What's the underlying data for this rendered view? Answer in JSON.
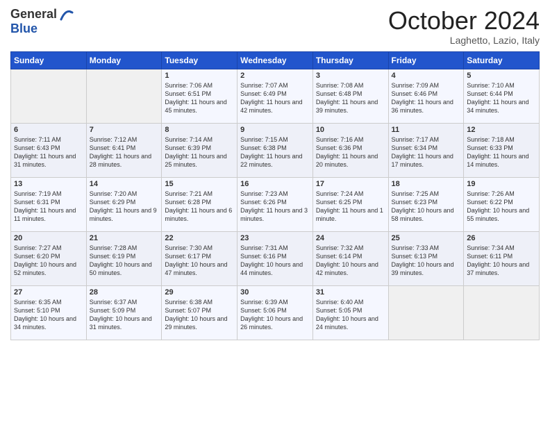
{
  "header": {
    "logo_general": "General",
    "logo_blue": "Blue",
    "title": "October 2024",
    "subtitle": "Laghetto, Lazio, Italy"
  },
  "days_of_week": [
    "Sunday",
    "Monday",
    "Tuesday",
    "Wednesday",
    "Thursday",
    "Friday",
    "Saturday"
  ],
  "weeks": [
    [
      {
        "day": null
      },
      {
        "day": null
      },
      {
        "day": "1",
        "sunrise": "Sunrise: 7:06 AM",
        "sunset": "Sunset: 6:51 PM",
        "daylight": "Daylight: 11 hours and 45 minutes."
      },
      {
        "day": "2",
        "sunrise": "Sunrise: 7:07 AM",
        "sunset": "Sunset: 6:49 PM",
        "daylight": "Daylight: 11 hours and 42 minutes."
      },
      {
        "day": "3",
        "sunrise": "Sunrise: 7:08 AM",
        "sunset": "Sunset: 6:48 PM",
        "daylight": "Daylight: 11 hours and 39 minutes."
      },
      {
        "day": "4",
        "sunrise": "Sunrise: 7:09 AM",
        "sunset": "Sunset: 6:46 PM",
        "daylight": "Daylight: 11 hours and 36 minutes."
      },
      {
        "day": "5",
        "sunrise": "Sunrise: 7:10 AM",
        "sunset": "Sunset: 6:44 PM",
        "daylight": "Daylight: 11 hours and 34 minutes."
      }
    ],
    [
      {
        "day": "6",
        "sunrise": "Sunrise: 7:11 AM",
        "sunset": "Sunset: 6:43 PM",
        "daylight": "Daylight: 11 hours and 31 minutes."
      },
      {
        "day": "7",
        "sunrise": "Sunrise: 7:12 AM",
        "sunset": "Sunset: 6:41 PM",
        "daylight": "Daylight: 11 hours and 28 minutes."
      },
      {
        "day": "8",
        "sunrise": "Sunrise: 7:14 AM",
        "sunset": "Sunset: 6:39 PM",
        "daylight": "Daylight: 11 hours and 25 minutes."
      },
      {
        "day": "9",
        "sunrise": "Sunrise: 7:15 AM",
        "sunset": "Sunset: 6:38 PM",
        "daylight": "Daylight: 11 hours and 22 minutes."
      },
      {
        "day": "10",
        "sunrise": "Sunrise: 7:16 AM",
        "sunset": "Sunset: 6:36 PM",
        "daylight": "Daylight: 11 hours and 20 minutes."
      },
      {
        "day": "11",
        "sunrise": "Sunrise: 7:17 AM",
        "sunset": "Sunset: 6:34 PM",
        "daylight": "Daylight: 11 hours and 17 minutes."
      },
      {
        "day": "12",
        "sunrise": "Sunrise: 7:18 AM",
        "sunset": "Sunset: 6:33 PM",
        "daylight": "Daylight: 11 hours and 14 minutes."
      }
    ],
    [
      {
        "day": "13",
        "sunrise": "Sunrise: 7:19 AM",
        "sunset": "Sunset: 6:31 PM",
        "daylight": "Daylight: 11 hours and 11 minutes."
      },
      {
        "day": "14",
        "sunrise": "Sunrise: 7:20 AM",
        "sunset": "Sunset: 6:29 PM",
        "daylight": "Daylight: 11 hours and 9 minutes."
      },
      {
        "day": "15",
        "sunrise": "Sunrise: 7:21 AM",
        "sunset": "Sunset: 6:28 PM",
        "daylight": "Daylight: 11 hours and 6 minutes."
      },
      {
        "day": "16",
        "sunrise": "Sunrise: 7:23 AM",
        "sunset": "Sunset: 6:26 PM",
        "daylight": "Daylight: 11 hours and 3 minutes."
      },
      {
        "day": "17",
        "sunrise": "Sunrise: 7:24 AM",
        "sunset": "Sunset: 6:25 PM",
        "daylight": "Daylight: 11 hours and 1 minute."
      },
      {
        "day": "18",
        "sunrise": "Sunrise: 7:25 AM",
        "sunset": "Sunset: 6:23 PM",
        "daylight": "Daylight: 10 hours and 58 minutes."
      },
      {
        "day": "19",
        "sunrise": "Sunrise: 7:26 AM",
        "sunset": "Sunset: 6:22 PM",
        "daylight": "Daylight: 10 hours and 55 minutes."
      }
    ],
    [
      {
        "day": "20",
        "sunrise": "Sunrise: 7:27 AM",
        "sunset": "Sunset: 6:20 PM",
        "daylight": "Daylight: 10 hours and 52 minutes."
      },
      {
        "day": "21",
        "sunrise": "Sunrise: 7:28 AM",
        "sunset": "Sunset: 6:19 PM",
        "daylight": "Daylight: 10 hours and 50 minutes."
      },
      {
        "day": "22",
        "sunrise": "Sunrise: 7:30 AM",
        "sunset": "Sunset: 6:17 PM",
        "daylight": "Daylight: 10 hours and 47 minutes."
      },
      {
        "day": "23",
        "sunrise": "Sunrise: 7:31 AM",
        "sunset": "Sunset: 6:16 PM",
        "daylight": "Daylight: 10 hours and 44 minutes."
      },
      {
        "day": "24",
        "sunrise": "Sunrise: 7:32 AM",
        "sunset": "Sunset: 6:14 PM",
        "daylight": "Daylight: 10 hours and 42 minutes."
      },
      {
        "day": "25",
        "sunrise": "Sunrise: 7:33 AM",
        "sunset": "Sunset: 6:13 PM",
        "daylight": "Daylight: 10 hours and 39 minutes."
      },
      {
        "day": "26",
        "sunrise": "Sunrise: 7:34 AM",
        "sunset": "Sunset: 6:11 PM",
        "daylight": "Daylight: 10 hours and 37 minutes."
      }
    ],
    [
      {
        "day": "27",
        "sunrise": "Sunrise: 6:35 AM",
        "sunset": "Sunset: 5:10 PM",
        "daylight": "Daylight: 10 hours and 34 minutes."
      },
      {
        "day": "28",
        "sunrise": "Sunrise: 6:37 AM",
        "sunset": "Sunset: 5:09 PM",
        "daylight": "Daylight: 10 hours and 31 minutes."
      },
      {
        "day": "29",
        "sunrise": "Sunrise: 6:38 AM",
        "sunset": "Sunset: 5:07 PM",
        "daylight": "Daylight: 10 hours and 29 minutes."
      },
      {
        "day": "30",
        "sunrise": "Sunrise: 6:39 AM",
        "sunset": "Sunset: 5:06 PM",
        "daylight": "Daylight: 10 hours and 26 minutes."
      },
      {
        "day": "31",
        "sunrise": "Sunrise: 6:40 AM",
        "sunset": "Sunset: 5:05 PM",
        "daylight": "Daylight: 10 hours and 24 minutes."
      },
      {
        "day": null
      },
      {
        "day": null
      }
    ]
  ]
}
